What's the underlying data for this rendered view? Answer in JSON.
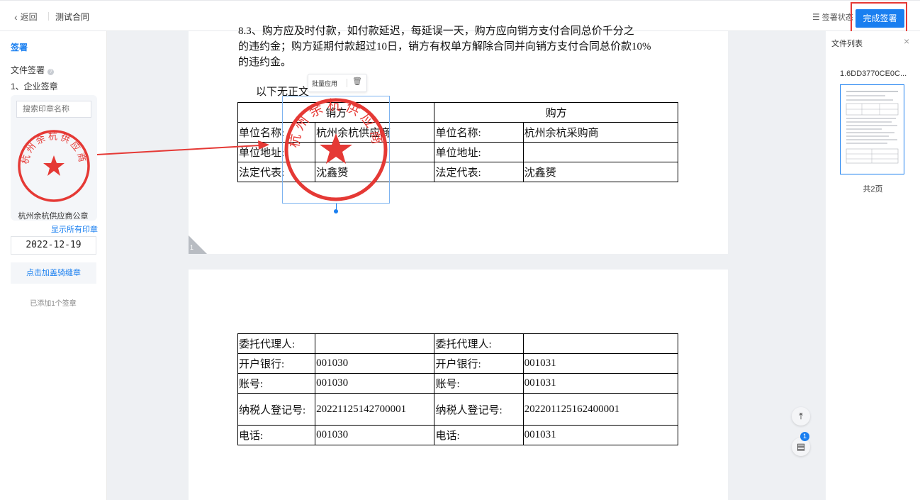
{
  "header": {
    "back_label": "返回",
    "doc_title": "测试合同",
    "status_label": "签署状态",
    "finish_label": "完成签署"
  },
  "sidebar": {
    "section_title": "签署",
    "file_sign_label": "文件签署",
    "enterprise_label": "1、企业签章",
    "search_placeholder": "搜索印章名称",
    "seal_name": "杭州余杭供应商公章",
    "show_all_label": "显示所有印章",
    "date_value": "2022-12-19",
    "add_seam_label": "点击加盖骑缝章",
    "added_count_text": "已添加1个签章"
  },
  "seal": {
    "ring_text": "杭州余杭供应商",
    "color": "#e53935"
  },
  "document": {
    "page1": {
      "line_top_partial": "8.3、购方应及时付款，如付款延迟，每延误一天，购方应向销方支付合同总价千分之",
      "line_1": "的违约金；购方延期付款超过10日，销方有权单方解除合同并向销方支付合同总价款10%",
      "line_2": "的违约金。",
      "no_text": "以下无正文",
      "page_num": "1",
      "table": {
        "seller_header": "销方",
        "buyer_header": "购方",
        "rows": [
          [
            "单位名称:",
            "杭州余杭供应商",
            "单位名称:",
            "杭州余杭采购商"
          ],
          [
            "单位地址:",
            "",
            "单位地址:",
            ""
          ],
          [
            "法定代表:",
            "沈鑫赟",
            "法定代表:",
            "沈鑫赟"
          ]
        ]
      },
      "float_toolbar": {
        "batch_apply": "批量应用"
      }
    },
    "page2": {
      "table": {
        "rows": [
          [
            "委托代理人:",
            "",
            "委托代理人:",
            ""
          ],
          [
            "开户银行:",
            "001030",
            "开户银行:",
            "001031"
          ],
          [
            "账号:",
            "001030",
            "账号:",
            "001031"
          ],
          [
            "纳税人登记号:",
            "20221125142700001",
            "纳税人登记号:",
            "202201125162400001"
          ],
          [
            "电话:",
            "001030",
            "电话:",
            "001031"
          ]
        ]
      }
    }
  },
  "file_panel": {
    "title": "文件列表",
    "file_name": "1.6DD3770CE0C...",
    "page_count": "共2页"
  },
  "float_buttons": {
    "badge_count": "1"
  },
  "colors": {
    "accent": "#1a7ff0",
    "annotation_red": "#e53935"
  }
}
